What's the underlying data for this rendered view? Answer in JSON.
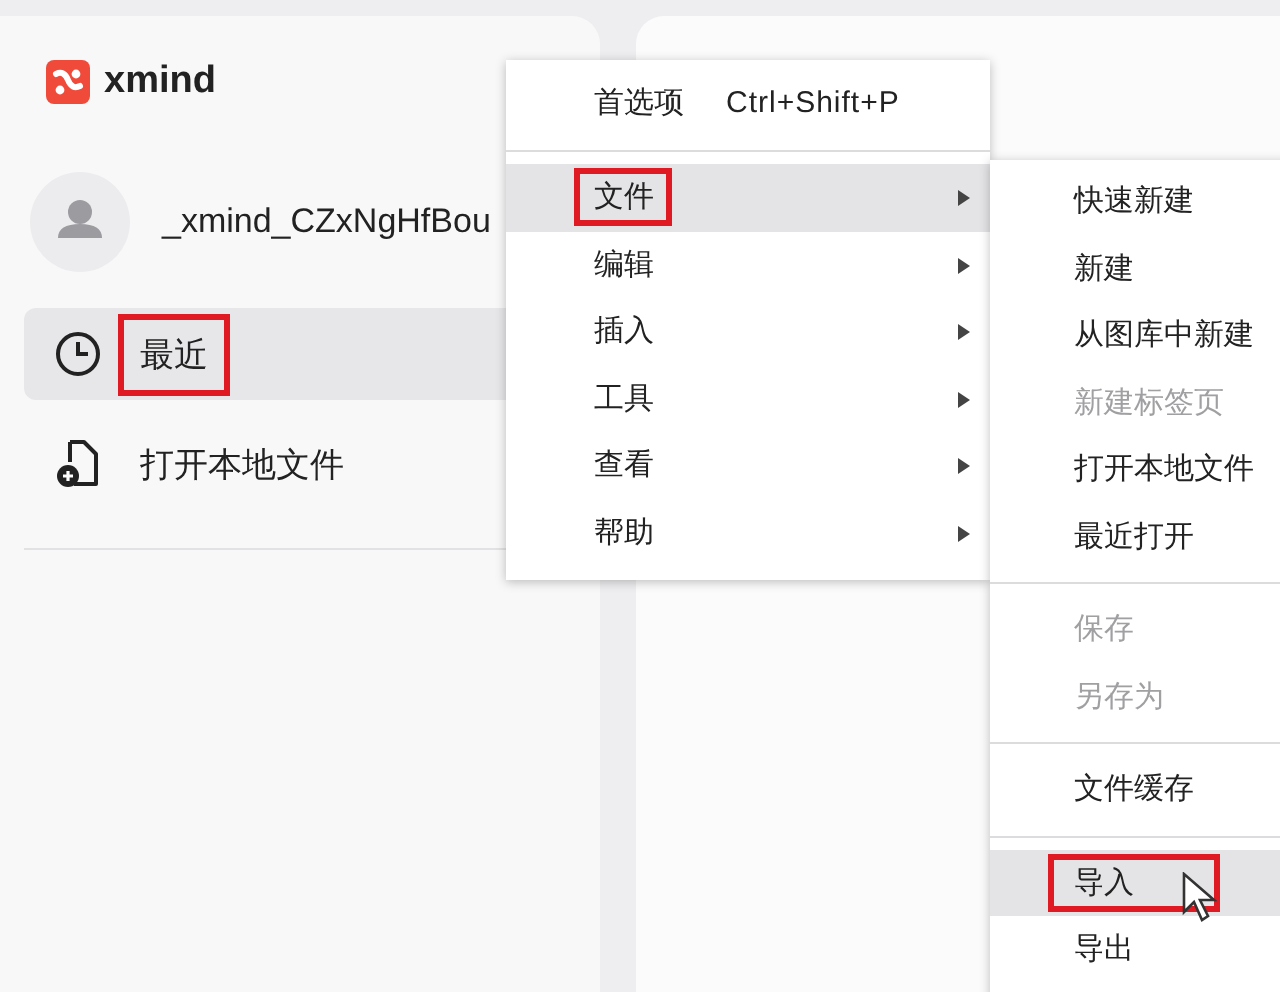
{
  "app": {
    "logo_text": "xmind"
  },
  "user": {
    "name": "_xmind_CZxNgHfBou"
  },
  "sidebar": {
    "items": [
      {
        "kind": "clock",
        "label": "最近",
        "selected": true,
        "highlighted": true
      },
      {
        "kind": "open-file",
        "label": "打开本地文件",
        "selected": false,
        "highlighted": false
      }
    ]
  },
  "context_menu": {
    "items": [
      {
        "kind": "command",
        "label": "首选项",
        "shortcut": "Ctrl+Shift+P"
      },
      {
        "kind": "separator"
      },
      {
        "kind": "submenu",
        "label": "文件",
        "selected": true,
        "highlighted": true
      },
      {
        "kind": "submenu",
        "label": "编辑",
        "selected": false,
        "highlighted": false
      },
      {
        "kind": "submenu",
        "label": "插入",
        "selected": false,
        "highlighted": false
      },
      {
        "kind": "submenu",
        "label": "工具",
        "selected": false,
        "highlighted": false
      },
      {
        "kind": "submenu",
        "label": "查看",
        "selected": false,
        "highlighted": false
      },
      {
        "kind": "submenu",
        "label": "帮助",
        "selected": false,
        "highlighted": false
      }
    ]
  },
  "submenu": {
    "items": [
      {
        "kind": "command",
        "label": "快速新建",
        "disabled": false,
        "selected": false,
        "highlighted": false
      },
      {
        "kind": "command",
        "label": "新建",
        "disabled": false,
        "selected": false,
        "highlighted": false
      },
      {
        "kind": "command",
        "label": "从图库中新建",
        "disabled": false,
        "selected": false,
        "highlighted": false
      },
      {
        "kind": "command",
        "label": "新建标签页",
        "disabled": true,
        "selected": false,
        "highlighted": false
      },
      {
        "kind": "command",
        "label": "打开本地文件",
        "disabled": false,
        "selected": false,
        "highlighted": false
      },
      {
        "kind": "command",
        "label": "最近打开",
        "disabled": false,
        "selected": false,
        "highlighted": false
      },
      {
        "kind": "separator"
      },
      {
        "kind": "command",
        "label": "保存",
        "disabled": true,
        "selected": false,
        "highlighted": false
      },
      {
        "kind": "command",
        "label": "另存为",
        "disabled": true,
        "selected": false,
        "highlighted": false
      },
      {
        "kind": "separator"
      },
      {
        "kind": "command",
        "label": "文件缓存",
        "disabled": false,
        "selected": false,
        "highlighted": false
      },
      {
        "kind": "separator"
      },
      {
        "kind": "command",
        "label": "导入",
        "disabled": false,
        "selected": true,
        "highlighted": true
      },
      {
        "kind": "command",
        "label": "导出",
        "disabled": false,
        "selected": false,
        "highlighted": false
      }
    ]
  }
}
